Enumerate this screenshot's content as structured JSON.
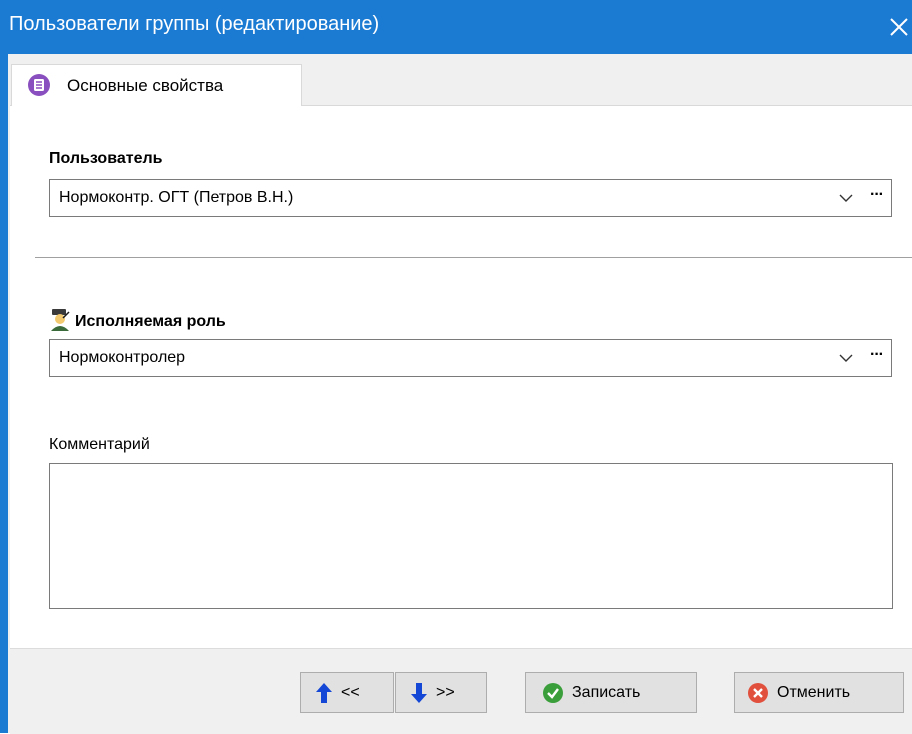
{
  "window": {
    "title": "Пользователи группы (редактирование)"
  },
  "tabs": [
    {
      "label": "Основные свойства"
    }
  ],
  "fields": {
    "user": {
      "label": "Пользователь",
      "value": "Нормоконтр. ОГТ (Петров В.Н.)"
    },
    "role": {
      "label": "Исполняемая роль",
      "value": "Нормоконтролер"
    },
    "comment": {
      "label": "Комментарий",
      "value": ""
    }
  },
  "buttons": {
    "prev_label": "<<",
    "next_label": ">>",
    "save_label": "Записать",
    "cancel_label": "Отменить"
  },
  "icons": {
    "close": "close-icon",
    "tab": "list-icon",
    "role": "role-user-icon",
    "prev": "arrow-up-icon",
    "next": "arrow-down-icon",
    "save": "check-circle-icon",
    "cancel": "x-circle-icon"
  },
  "colors": {
    "titlebar": "#1b7ad2",
    "save_icon": "#3a9f3a",
    "cancel_icon": "#e0503c",
    "arrow": "#1547d6",
    "tab_icon": "#8a4fbf"
  }
}
